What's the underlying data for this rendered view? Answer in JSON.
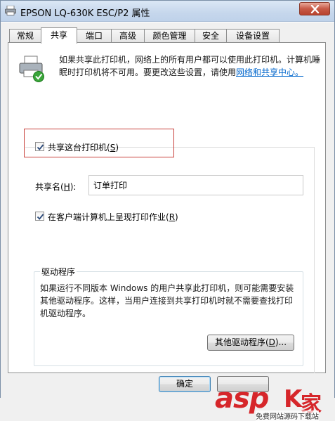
{
  "window": {
    "title": "EPSON LQ-630K ESC/P2 属性",
    "close_label": "×"
  },
  "tabs": [
    {
      "label": "常规"
    },
    {
      "label": "共享",
      "active": true
    },
    {
      "label": "端口"
    },
    {
      "label": "高级"
    },
    {
      "label": "颜色管理"
    },
    {
      "label": "安全"
    },
    {
      "label": "设备设置"
    }
  ],
  "info": {
    "text": "如果共享此打印机，网络上的所有用户都可以使用此打印机。计算机睡眠时打印机将不可用。要更改这些设置，请使用",
    "link": "网络和共享中心。"
  },
  "share_checkbox": {
    "label_prefix": "共享这台打印机(",
    "accel": "S",
    "label_suffix": ")",
    "checked": true
  },
  "share_name": {
    "label_prefix": "共享名(",
    "accel": "H",
    "label_suffix": "):",
    "value": "订单打印"
  },
  "render_checkbox": {
    "label_prefix": "在客户端计算机上呈现打印作业(",
    "accel": "R",
    "label_suffix": ")",
    "checked": true
  },
  "drivers": {
    "title": "驱动程序",
    "description": "如果运行不同版本 Windows 的用户共享此打印机，则可能需要安装其他驱动程序。这样，当用户连接到共享打印机时就不需要查找打印机驱动程序。",
    "button_prefix": "其他驱动程序(",
    "button_accel": "D",
    "button_suffix": ")..."
  },
  "buttons": {
    "ok": "确定"
  },
  "watermark": {
    "asp": "asp",
    "k": "K",
    "jia": "家",
    "sub": "免费网站源码下载站"
  },
  "colors": {
    "accent": "#0066cc",
    "highlight_border": "#c8403b",
    "watermark": "#d6262a"
  }
}
